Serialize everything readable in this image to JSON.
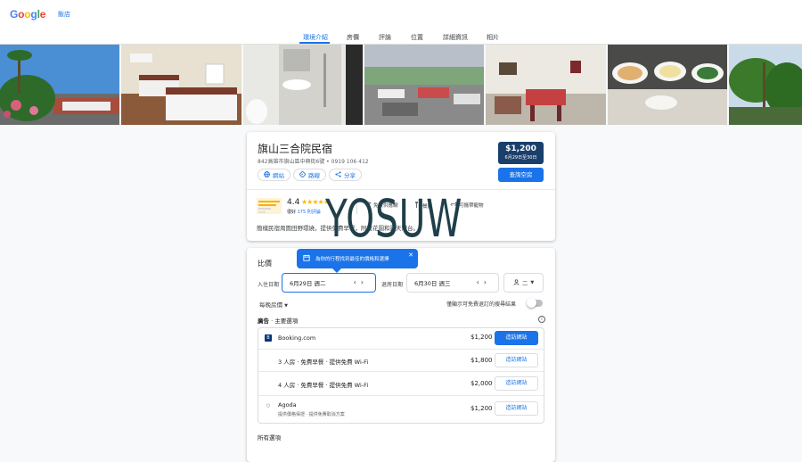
{
  "header": {
    "logo_letters": [
      {
        "ch": "G",
        "color": "#4285F4"
      },
      {
        "ch": "o",
        "color": "#EA4335"
      },
      {
        "ch": "o",
        "color": "#FBBC05"
      },
      {
        "ch": "g",
        "color": "#4285F4"
      },
      {
        "ch": "l",
        "color": "#34A853"
      },
      {
        "ch": "e",
        "color": "#EA4335"
      }
    ],
    "breadcrumb": "飯店"
  },
  "tabs": [
    "環境介紹",
    "房價",
    "評論",
    "位置",
    "詳細資訊",
    "相片"
  ],
  "active_tab": 0,
  "hotel": {
    "name": "旗山三合院民宿",
    "address": "842高雄市旗山區中興街6號 • 0919 106 412",
    "actions": {
      "website": "網站",
      "directions": "路線",
      "share": "分享"
    },
    "price": "$1,200",
    "price_dates": "6月29日至30日",
    "check_button": "查詢空房",
    "rating": "4.4",
    "stars": "★★★★★",
    "rating_label": "很好",
    "reviews": "175 則評論",
    "amenities": {
      "wifi": "免費供應網",
      "restaurant": "餐廳",
      "other": "可攜帶寵物"
    },
    "description": "簡樸民宿周圍田野環繞，提供免費早餐，附設花園和露天陽台。"
  },
  "watermark": "YOSUW",
  "pricing": {
    "title": "比價",
    "tooltip": "為你的行程找到最佳的價格和選擇",
    "tooltip_close": "✕",
    "checkin_label": "入住日期",
    "checkin_value": "6月29日 週二",
    "checkout_label": "退房日期",
    "checkout_value": "6月30日 週三",
    "guests_value": "二",
    "nightly": "每晚房價",
    "toggle_label": "僅顯示可免費退訂的搜尋結果",
    "ads_label": "廣告",
    "ads_title": " · 主要選項",
    "offers": [
      {
        "name": "Booking.com",
        "sub": "",
        "price": "$1,200",
        "button": "造訪網站",
        "primary": true,
        "icon": "B"
      },
      {
        "name": "3 人房 · 免費早餐 · 提供免費 Wi-Fi",
        "sub": "",
        "price": "$1,800",
        "button": "造訪網站",
        "primary": false,
        "icon": ""
      },
      {
        "name": "4 人房 · 免費早餐 · 提供免費 Wi-Fi",
        "sub": "",
        "price": "$2,000",
        "button": "造訪網站",
        "primary": false,
        "icon": ""
      },
      {
        "name": "Agoda",
        "sub": "提供價格保證 · 提供免費取消方案",
        "price": "$1,200",
        "button": "造訪網站",
        "primary": false,
        "icon": "○"
      }
    ],
    "all_options": "所有選項"
  },
  "colors": {
    "accent": "#1a73e8",
    "price_box": "#1a3f6b"
  }
}
